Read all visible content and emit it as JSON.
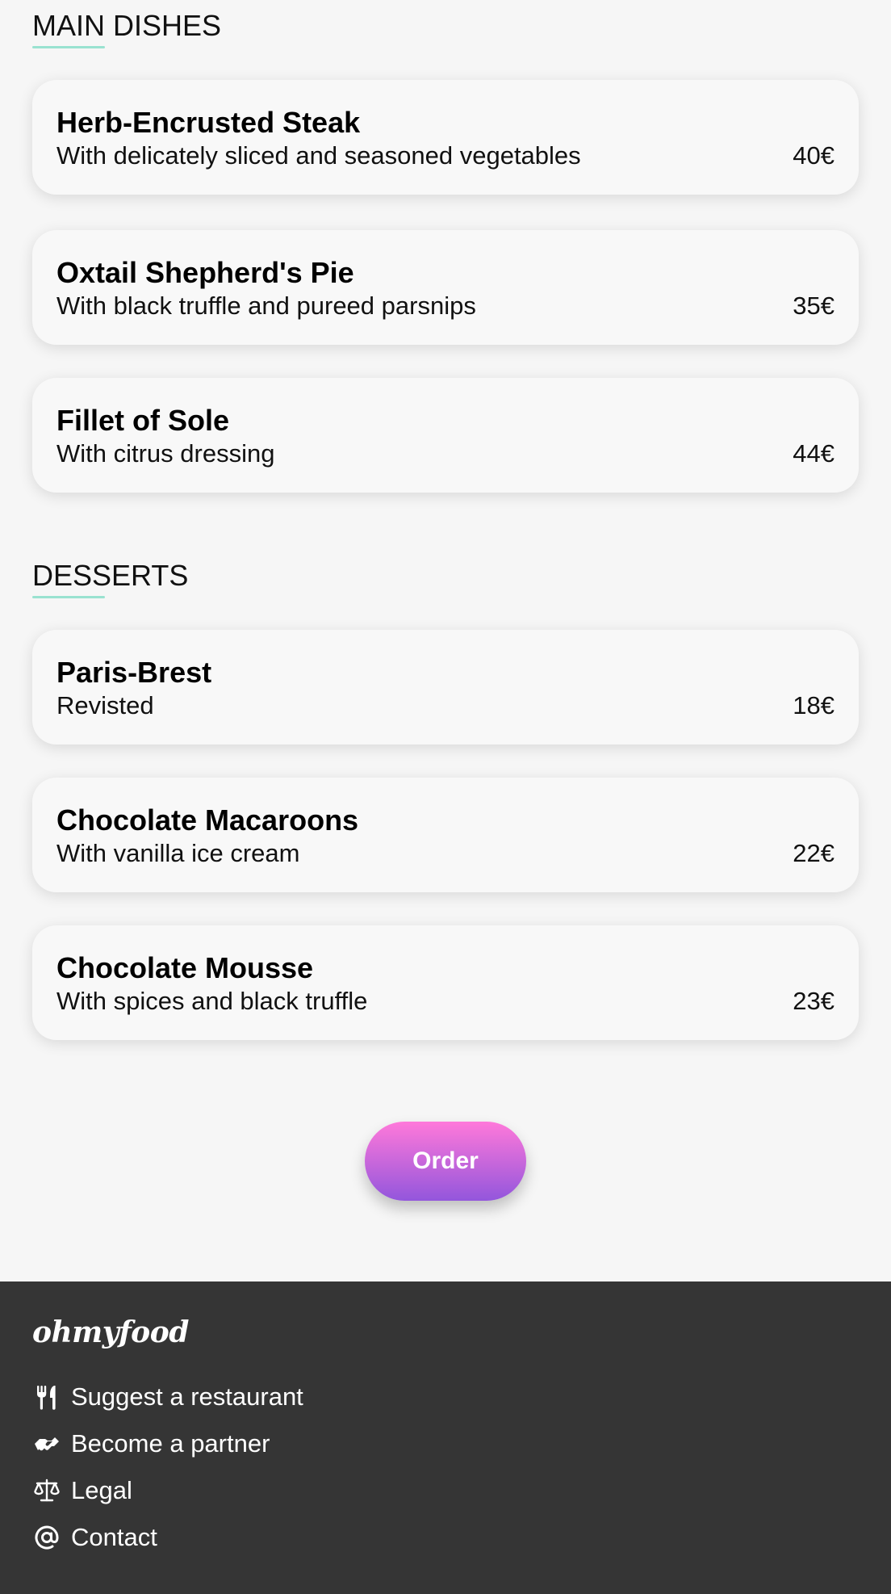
{
  "sections": [
    {
      "title": "MAIN DISHES",
      "dishes": [
        {
          "name": "Herb-Encrusted Steak",
          "description": "With delicately sliced and seasoned vegetables",
          "price": "40€"
        },
        {
          "name": "Oxtail Shepherd's Pie",
          "description": "With black truffle and pureed parsnips",
          "price": "35€"
        },
        {
          "name": "Fillet of Sole",
          "description": "With citrus dressing",
          "price": "44€"
        }
      ]
    },
    {
      "title": "DESSERTS",
      "dishes": [
        {
          "name": "Paris-Brest",
          "description": "Revisted",
          "price": "18€"
        },
        {
          "name": "Chocolate Macaroons",
          "description": "With vanilla ice cream",
          "price": "22€"
        },
        {
          "name": "Chocolate Mousse",
          "description": "With spices and black truffle",
          "price": "23€"
        }
      ]
    }
  ],
  "order_button": {
    "label": "Order"
  },
  "footer": {
    "logo": "ohmyfood",
    "links": [
      {
        "label": "Suggest a restaurant",
        "icon": "utensils-icon"
      },
      {
        "label": "Become a partner",
        "icon": "handshake-icon"
      },
      {
        "label": "Legal",
        "icon": "scale-icon"
      },
      {
        "label": "Contact",
        "icon": "at-icon"
      }
    ]
  },
  "colors": {
    "accent_underline": "#99e2d0",
    "button_gradient_top": "#ff79da",
    "button_gradient_bottom": "#9356dc",
    "footer_background": "#353535",
    "page_background": "#f6f6f6"
  }
}
